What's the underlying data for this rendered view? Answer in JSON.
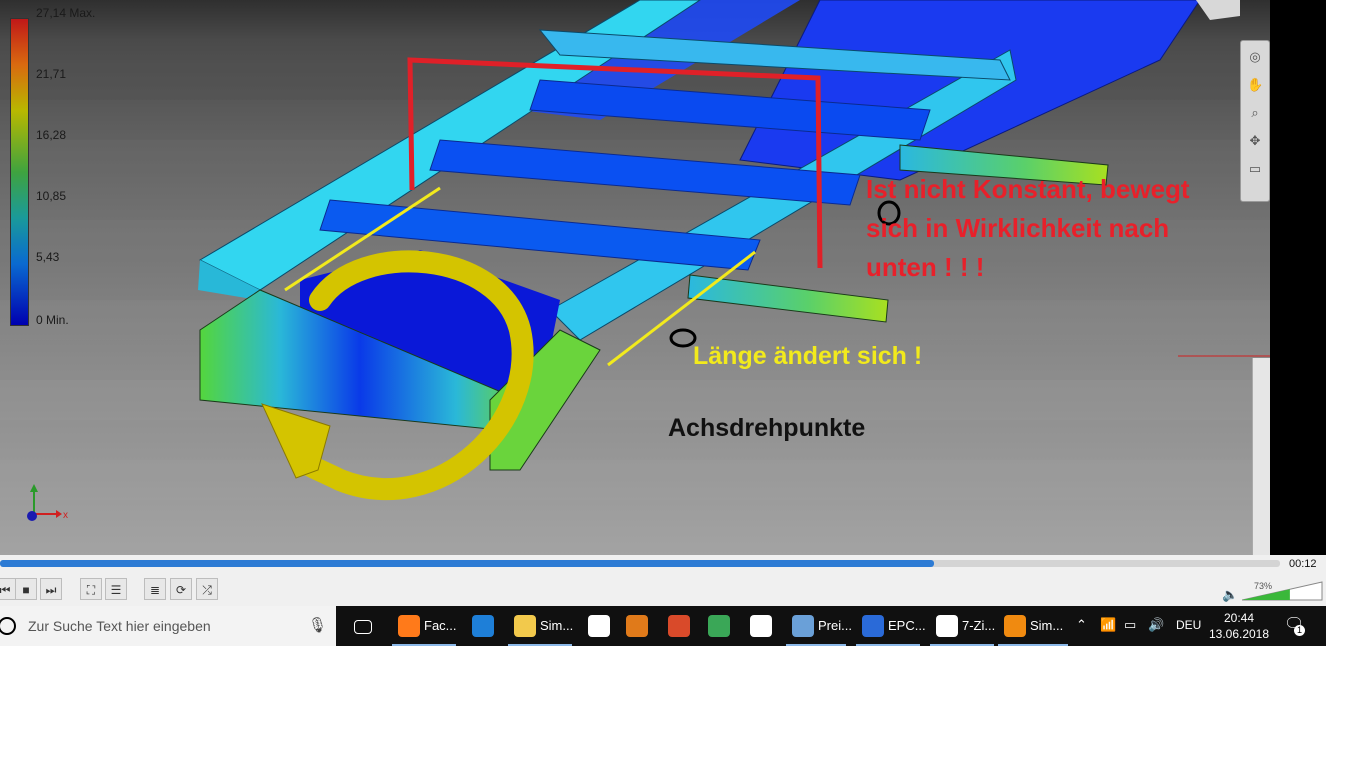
{
  "legend": {
    "title": "27,14 Max.",
    "labels": [
      "21,71",
      "16,28",
      "10,85",
      "5,43",
      "0 Min."
    ]
  },
  "annotations": {
    "red_line1": "Ist nicht Konstant, bewegt",
    "red_line2": "sich in Wirklichkeit nach",
    "red_line3": "unten ! ! !",
    "yellow": "Länge ändert sich !",
    "black": "Achsdrehpunkte"
  },
  "axis_triad": {
    "x": "x"
  },
  "player": {
    "time": "00:12",
    "progress_fraction": 0.73,
    "volume": "73%",
    "volume_fraction": 0.73
  },
  "taskbar": {
    "search_placeholder": "Zur Suche Text hier eingeben",
    "apps": [
      {
        "label": "Fac...",
        "icon": "firefox-icon",
        "color": "#ff7a1a"
      },
      {
        "label": "",
        "icon": "edge-icon",
        "color": "#1e7fd8"
      },
      {
        "label": "Sim...",
        "icon": "folder-icon",
        "color": "#f2c94c"
      },
      {
        "label": "",
        "icon": "store-icon",
        "color": "#ffffff"
      },
      {
        "label": "",
        "icon": "media-player-icon",
        "color": "#e07a1a"
      },
      {
        "label": "",
        "icon": "photos-icon",
        "color": "#d94a2a"
      },
      {
        "label": "",
        "icon": "chrome-icon",
        "color": "#3aa757"
      },
      {
        "label": "",
        "icon": "mail-icon",
        "color": "#ffffff"
      },
      {
        "label": "Prei...",
        "icon": "spreadsheet-icon",
        "color": "#6aa0d8"
      },
      {
        "label": "EPC...",
        "icon": "epc-icon",
        "color": "#2a6ad8"
      },
      {
        "label": "7-Zi...",
        "icon": "seven-zip-icon",
        "color": "#ffffff"
      },
      {
        "label": "Sim...",
        "icon": "vlc-icon",
        "color": "#f08a10"
      }
    ],
    "lang": "DEU",
    "time": "20:44",
    "date": "13.06.2018",
    "notification_count": "1"
  }
}
